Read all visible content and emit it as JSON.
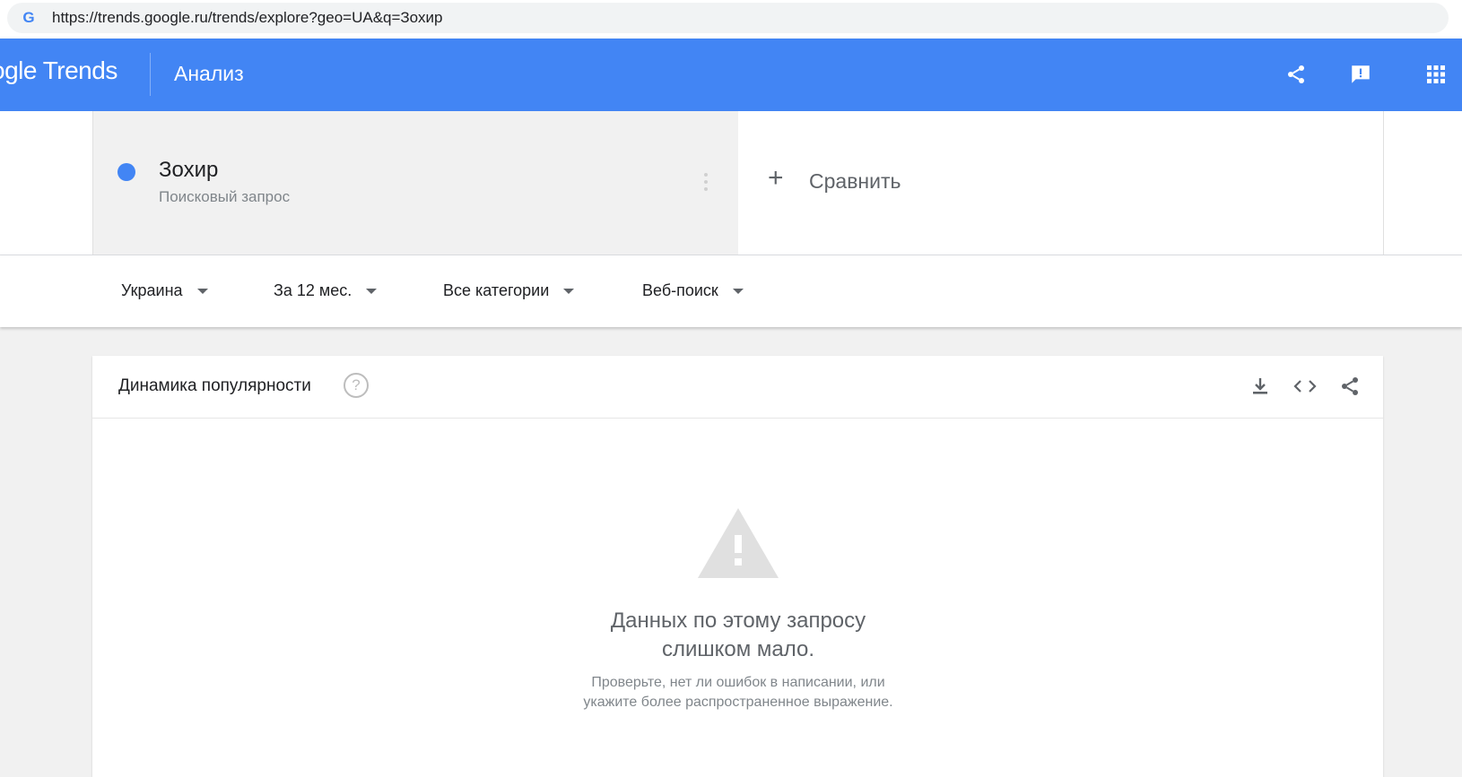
{
  "browser": {
    "url": "https://trends.google.ru/trends/explore?geo=UA&q=Зохир"
  },
  "header": {
    "logo": "ogle Trends",
    "page_title": "Анализ",
    "icons": [
      "share-icon",
      "feedback-icon",
      "apps-grid-icon"
    ],
    "color": "#4285f4"
  },
  "term": {
    "name": "Зохир",
    "type": "Поисковый запрос",
    "color": "#4285f4"
  },
  "compare": {
    "plus": "+",
    "label": "Сравнить"
  },
  "filters": [
    {
      "label": "Украина"
    },
    {
      "label": "За 12 мес."
    },
    {
      "label": "Все категории"
    },
    {
      "label": "Веб-поиск"
    }
  ],
  "interest_card": {
    "title": "Динамика популярности",
    "help": "?",
    "icons": [
      "download-icon",
      "embed-code-icon",
      "share-icon"
    ],
    "empty_title_line1": "Данных по этому запросу",
    "empty_title_line2": "слишком мало.",
    "empty_sub_line1": "Проверьте, нет ли ошибок в написании, или",
    "empty_sub_line2": "укажите более распространенное выражение."
  }
}
